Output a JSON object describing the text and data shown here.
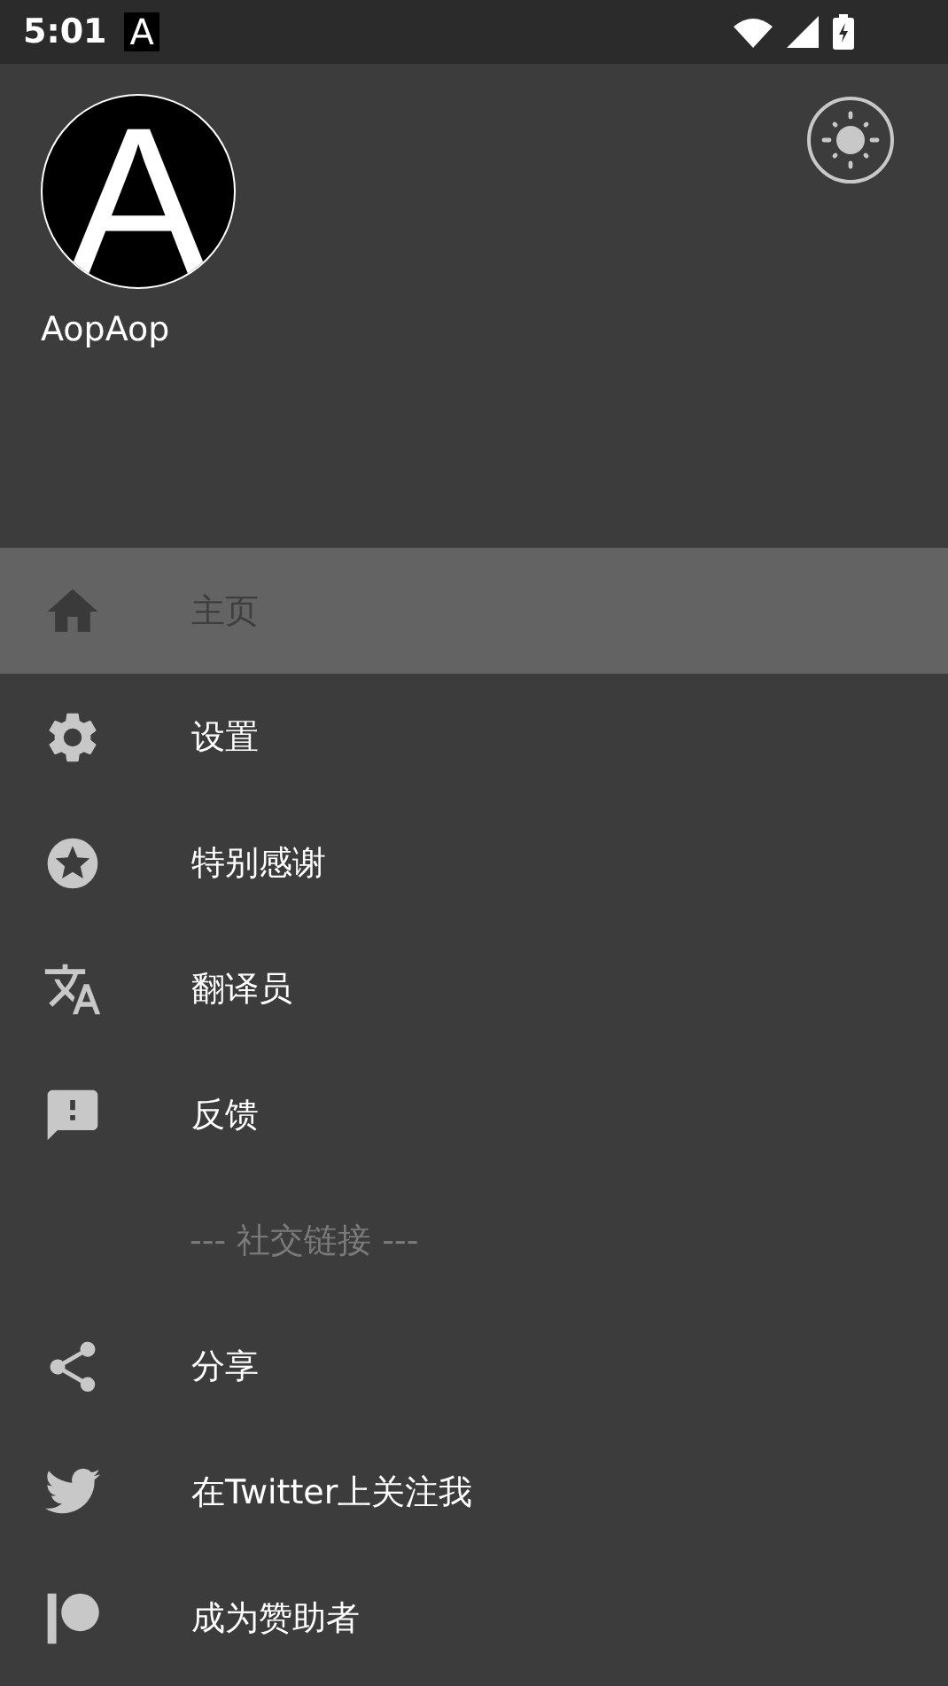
{
  "status_bar": {
    "time": "5:01",
    "app_badge": "A"
  },
  "header": {
    "avatar_letter": "A",
    "username": "AopAop"
  },
  "menu": [
    {
      "kind": "item",
      "label": "主页",
      "selected": true
    },
    {
      "kind": "item",
      "label": "设置",
      "selected": false
    },
    {
      "kind": "item",
      "label": "特别感谢",
      "selected": false
    },
    {
      "kind": "item",
      "label": "翻译员",
      "selected": false
    },
    {
      "kind": "item",
      "label": "反馈",
      "selected": false
    },
    {
      "kind": "section",
      "label": "--- 社交链接 ---"
    },
    {
      "kind": "item",
      "label": "分享",
      "selected": false
    },
    {
      "kind": "item",
      "label": "在Twitter上关注我",
      "selected": false
    },
    {
      "kind": "item",
      "label": "成为赞助者",
      "selected": false
    }
  ]
}
